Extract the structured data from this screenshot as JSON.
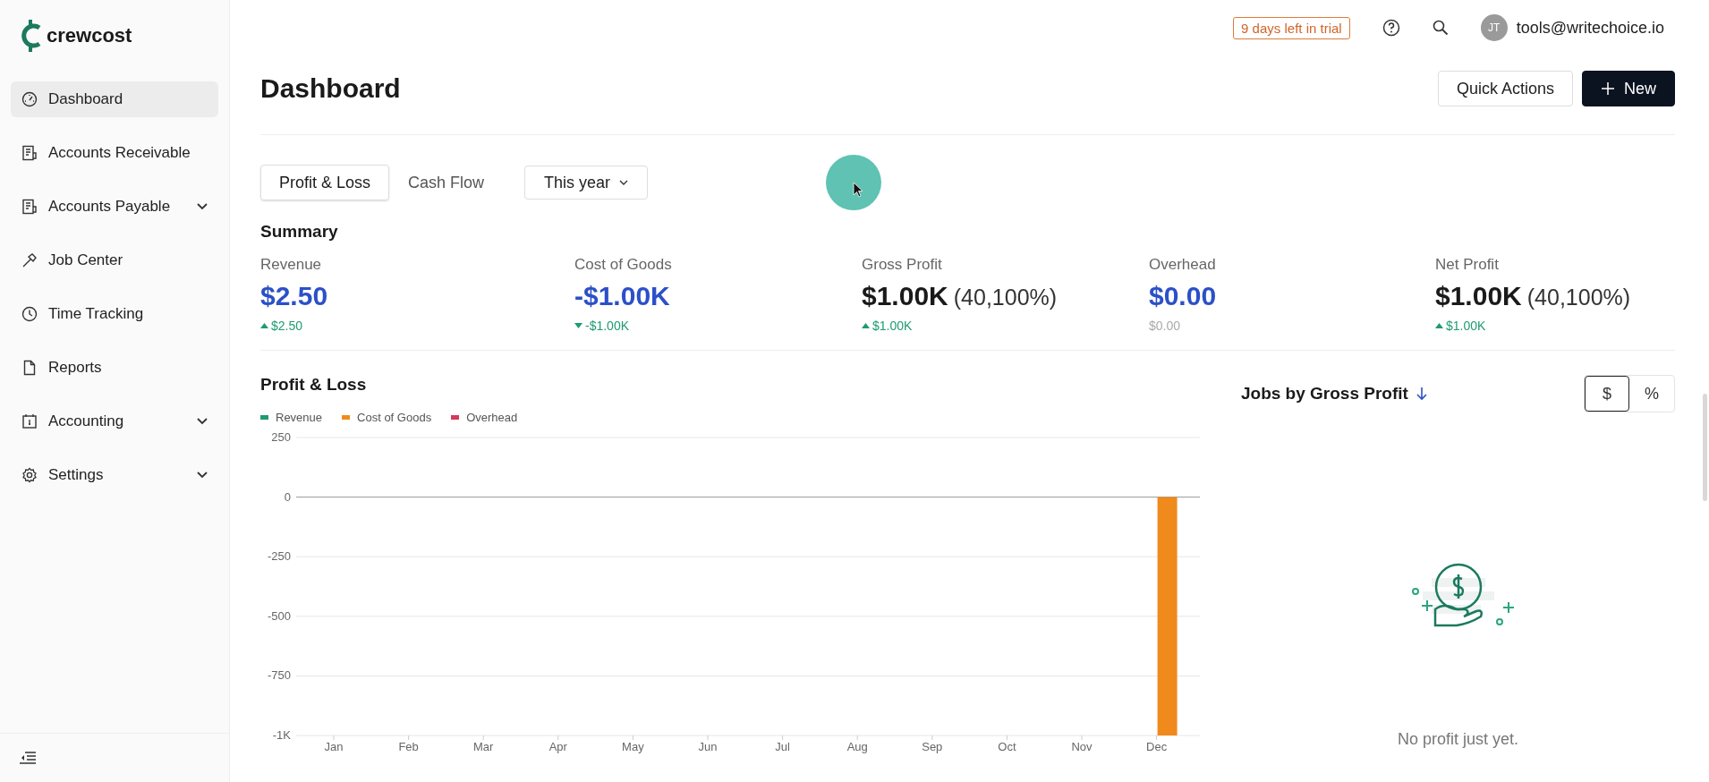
{
  "brand": {
    "name": "crewcost"
  },
  "sidebar": {
    "items": [
      {
        "label": "Dashboard",
        "expandable": false,
        "selected": true
      },
      {
        "label": "Accounts Receivable",
        "expandable": false,
        "selected": false
      },
      {
        "label": "Accounts Payable",
        "expandable": true,
        "selected": false
      },
      {
        "label": "Job Center",
        "expandable": false,
        "selected": false
      },
      {
        "label": "Time Tracking",
        "expandable": false,
        "selected": false
      },
      {
        "label": "Reports",
        "expandable": false,
        "selected": false
      },
      {
        "label": "Accounting",
        "expandable": true,
        "selected": false
      },
      {
        "label": "Settings",
        "expandable": true,
        "selected": false
      }
    ]
  },
  "topbar": {
    "trial_badge": "9 days left in trial",
    "avatar_initials": "JT",
    "user_email": "tools@writechoice.io"
  },
  "page": {
    "title": "Dashboard",
    "buttons": [
      {
        "label": "Quick Actions",
        "kind": "outline"
      },
      {
        "label": "New",
        "kind": "primary"
      }
    ]
  },
  "tabs": [
    {
      "label": "Profit & Loss",
      "selected": true
    },
    {
      "label": "Cash Flow",
      "selected": false
    }
  ],
  "period_dropdown": {
    "value": "This year"
  },
  "summary": {
    "title": "Summary",
    "metrics": [
      {
        "label": "Revenue",
        "value": "$2.50",
        "delta": "$2.50",
        "kind": "rise"
      },
      {
        "label": "Cost of Goods",
        "value": "-$1.00K",
        "delta": "-$1.00K",
        "kind": "fall"
      },
      {
        "label": "Gross Profit",
        "value": "$1.00K",
        "percent": "(40,100%)",
        "delta": "$1.00K",
        "kind": "rise"
      },
      {
        "label": "Overhead",
        "value": "$0.00",
        "delta": "$0.00",
        "kind": "flat"
      },
      {
        "label": "Net Profit",
        "value": "$1.00K",
        "percent": "(40,100%)",
        "delta": "$1.00K",
        "kind": "rise"
      }
    ]
  },
  "profit_loss": {
    "title": "Profit & Loss",
    "chart_data": {
      "type": "bar",
      "categories": [
        "Jan",
        "Feb",
        "Mar",
        "Apr",
        "May",
        "Jun",
        "Jul",
        "Aug",
        "Sep",
        "Oct",
        "Nov",
        "Dec"
      ],
      "series": [
        {
          "name": "Revenue",
          "color": "#1d9b73",
          "values": [
            0,
            0,
            0,
            0,
            0,
            0,
            0,
            0,
            0,
            0,
            0,
            0
          ]
        },
        {
          "name": "Cost of Goods",
          "color": "#f08a1c",
          "values": [
            0,
            0,
            0,
            0,
            0,
            0,
            0,
            0,
            0,
            0,
            0,
            -1000
          ]
        },
        {
          "name": "Overhead",
          "color": "#d6395c",
          "values": [
            0,
            0,
            0,
            0,
            0,
            0,
            0,
            0,
            0,
            0,
            0,
            0
          ]
        }
      ],
      "ylim": [
        -1000,
        250
      ],
      "yticks": [
        250,
        0,
        -250,
        -500,
        -750,
        {
          "value": -1000,
          "label": "-1K"
        }
      ],
      "grid": true
    }
  },
  "jobs_panel": {
    "title": "Jobs by Gross Profit",
    "toggle": [
      {
        "label": "$",
        "selected": true
      },
      {
        "label": "%",
        "selected": false
      }
    ],
    "empty_message": "No profit just yet."
  }
}
